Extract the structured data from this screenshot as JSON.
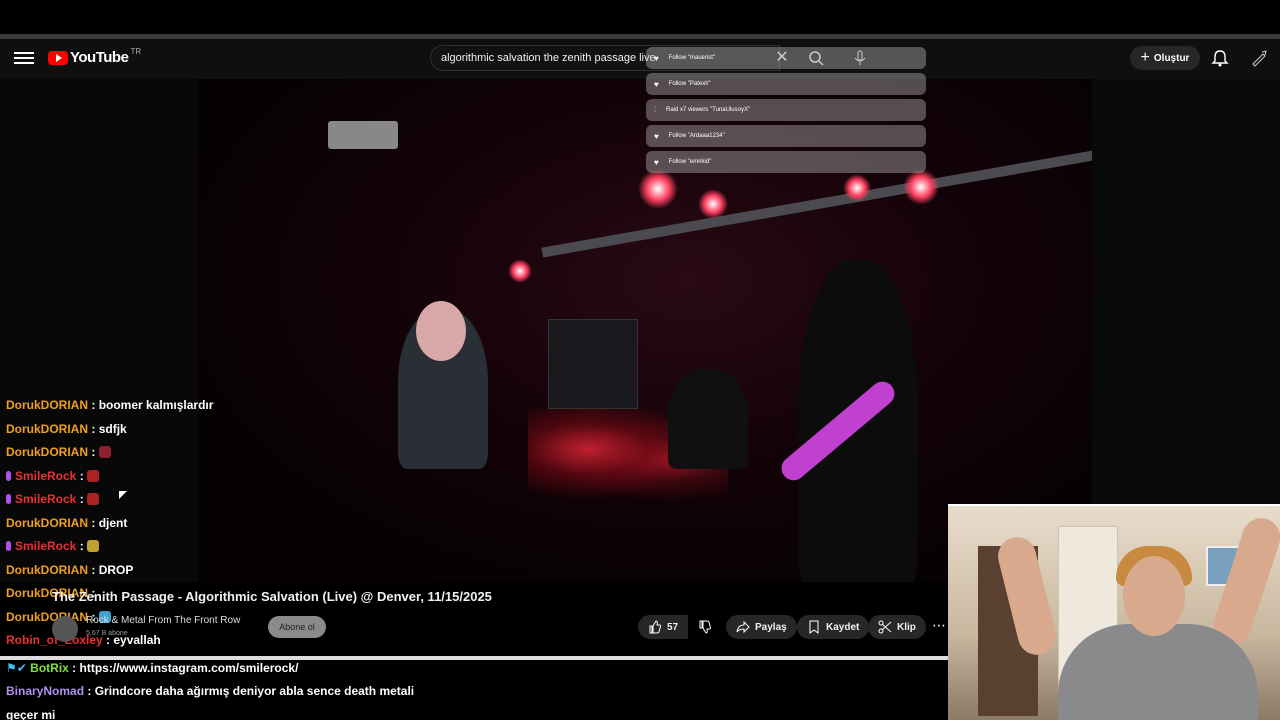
{
  "header": {
    "logo_text": "YouTube",
    "logo_region": "TR",
    "search_value": "algorithmic salvation the zenith passage live",
    "create_label": "Oluştur"
  },
  "alerts": [
    {
      "text": "Follow \"mauerist\"",
      "icon": "heart-icon"
    },
    {
      "text": "Follow \"Patexlr\"",
      "icon": "heart-icon"
    },
    {
      "text": "Raid x7 viewers \"TunaUlusoyX\"",
      "icon": "raid-icon"
    },
    {
      "text": "Follow \"Ardaaa1234\"",
      "icon": "heart-icon"
    },
    {
      "text": "Follow \"emirkid\"",
      "icon": "heart-icon"
    }
  ],
  "chat": [
    {
      "user": "DorukDORIAN",
      "sep": " : ",
      "msg": "boomer kalmışlardır",
      "cls": "u-doruk"
    },
    {
      "user": "DorukDORIAN",
      "sep": " : ",
      "msg": "sdfjk",
      "cls": "u-doruk"
    },
    {
      "user": "DorukDORIAN",
      "sep": " : ",
      "msg": "",
      "cls": "u-doruk",
      "emote": "#8a2030"
    },
    {
      "user": "SmileRock",
      "sep": " : ",
      "msg": "",
      "cls": "u-smile",
      "badge": true,
      "emote": "#b02020"
    },
    {
      "user": "SmileRock",
      "sep": " : ",
      "msg": "",
      "cls": "u-smile",
      "badge": true,
      "emote": "#b02020"
    },
    {
      "user": "DorukDORIAN",
      "sep": " : ",
      "msg": "djent",
      "cls": "u-doruk"
    },
    {
      "user": "SmileRock",
      "sep": " : ",
      "msg": "",
      "cls": "u-smile",
      "badge": true,
      "emote": "#c0a030"
    },
    {
      "user": "DorukDORIAN",
      "sep": " : ",
      "msg": "DROP",
      "cls": "u-doruk"
    },
    {
      "user": "DorukDORIAN",
      "sep": " : ",
      "msg": "",
      "cls": "u-doruk"
    },
    {
      "user": "DorukDORIAN",
      "sep": " : ",
      "msg": "",
      "cls": "u-doruk",
      "emote": "#40a0d0"
    },
    {
      "user": "Robin_of_Loxley",
      "sep": " : ",
      "msg": "eyvallah",
      "cls": "u-robin"
    },
    {
      "user": "BotRix",
      "sep": " : ",
      "msg": "https://www.instagram.com/smilerock/",
      "cls": "u-botrix",
      "botbadge": true
    },
    {
      "user": "BinaryNomad",
      "sep": " : ",
      "msg": "Grindcore daha ağırmış deniyor abla sence death metali",
      "cls": "u-binary"
    },
    {
      "user": "",
      "sep": "",
      "msg": "geçer mi",
      "cls": "msg"
    }
  ],
  "video": {
    "title": "The Zenith Passage - Algorithmic Salvation (Live) @ Denver, 11/15/2025",
    "channel": "Rock & Metal From The Front Row",
    "subscribers": "5,67 B abone",
    "subscribe_label": "Abone ol",
    "likes": "57",
    "share_label": "Paylaş",
    "save_label": "Kaydet",
    "clip_label": "Klip",
    "more_label": "⋯"
  }
}
